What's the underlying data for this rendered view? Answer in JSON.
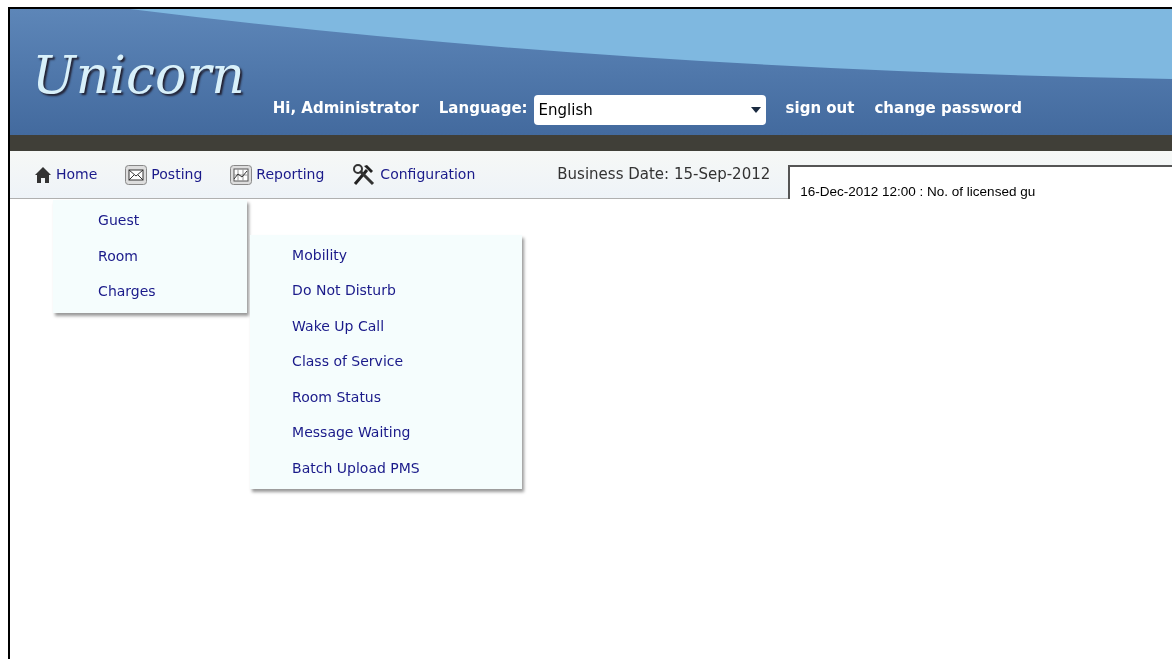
{
  "header": {
    "logo": "Unicorn",
    "greeting": "Hi, Administrator",
    "language_label": "Language:",
    "language": "English",
    "links": [
      "sign out",
      "change password"
    ]
  },
  "nav": [
    {
      "label": "Home",
      "kind": "home",
      "open": false
    },
    {
      "label": "Posting",
      "kind": "mail",
      "open": true,
      "items": [
        {
          "label": "Guest",
          "expanded": false
        },
        {
          "label": "Room",
          "expanded": true,
          "children": [
            {
              "label": "Mobility"
            },
            {
              "label": "Do Not Disturb"
            },
            {
              "label": "Wake Up Call"
            },
            {
              "label": "Class of Service"
            },
            {
              "label": "Room Status"
            },
            {
              "label": "Message Waiting"
            },
            {
              "label": "Batch Upload PMS"
            }
          ]
        },
        {
          "label": "Charges",
          "expanded": false
        }
      ]
    },
    {
      "label": "Reporting",
      "kind": "chart",
      "open": false
    },
    {
      "label": "Configuration",
      "kind": "tools",
      "open": false
    }
  ],
  "business_date": "Business Date: 15-Sep-2012",
  "ticker": "16-Dec-2012 12:00 : No. of licensed gu"
}
